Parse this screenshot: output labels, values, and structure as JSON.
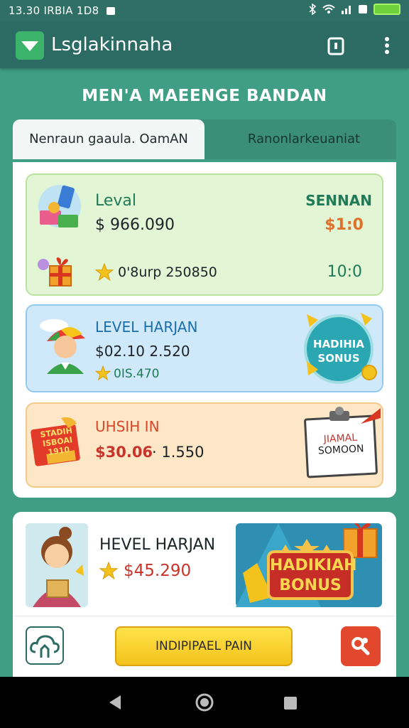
{
  "status": {
    "time_text": "13.30 IRBIA 1D8"
  },
  "app": {
    "title": "Lsglakinnaha"
  },
  "heading": "MEN'A MAEENGE BANDAN",
  "tabs": [
    {
      "label": "Nenraun gaaula. OamAN"
    },
    {
      "label": "Ranonlarkeuaniat"
    }
  ],
  "cards": [
    {
      "title": "Leval",
      "amount": "$ 966.090",
      "right_label": "SENNAN",
      "right_value": "$1:0",
      "sub_text": "0'8urp 250850",
      "sub_value": "10:0"
    },
    {
      "title": "LEVEL HARJAN",
      "amount": "$02.10 2.520",
      "sub_text": "0IS.470",
      "badge_text": "HADIHIA SONUS"
    },
    {
      "title": "UHSIH IN",
      "amount_red": "$30.06",
      "amount_dark": "·  1.550",
      "stamp_text": "STADIH ISBOAI 1910",
      "note_title": "JIAMAL",
      "note_text": "SOMOON"
    }
  ],
  "bottom_card": {
    "title": "HEVEL HARJAN",
    "amount": "$45.290",
    "banner_text": "HADIKIAH BONUS"
  },
  "actions": {
    "main_button": "INDIPIPAEL PAIN"
  },
  "colors": {
    "background": "#3f9e83",
    "appbar": "#2c6b63",
    "accent_yellow": "#f3c21b",
    "accent_red": "#e2482e"
  }
}
